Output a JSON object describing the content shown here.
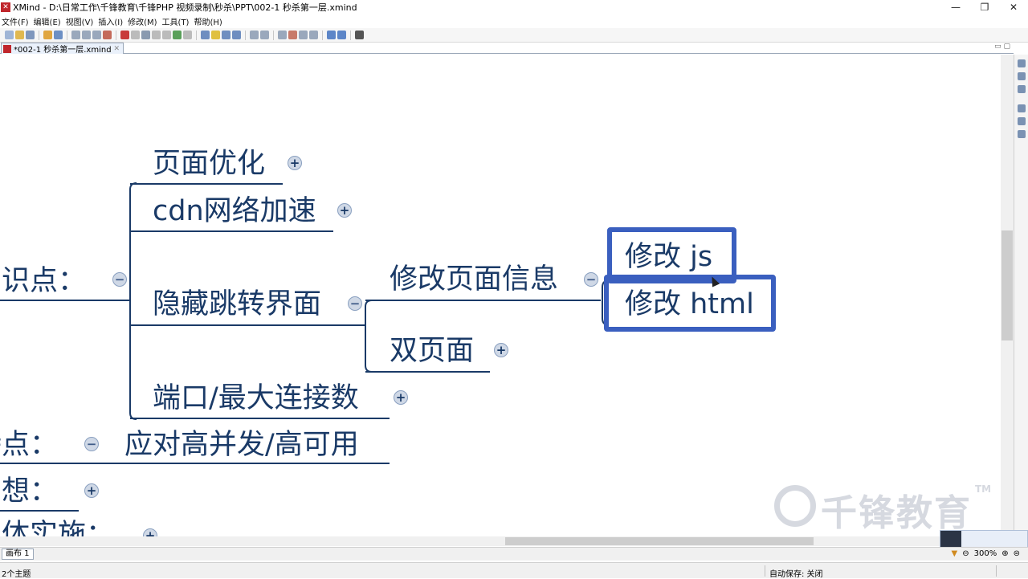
{
  "window": {
    "title": "XMind - D:\\日常工作\\千锋教育\\千锋PHP 视频录制\\秒杀\\PPT\\002-1 秒杀第一层.xmind",
    "minimize": "—",
    "restore": "❐",
    "close": "✕"
  },
  "menu": [
    "文件(F)",
    "编辑(E)",
    "视图(V)",
    "插入(I)",
    "修改(M)",
    "工具(T)",
    "帮助(H)"
  ],
  "editor_tab": {
    "label": "*002-1 秒杀第一层.xmind",
    "close": "✕",
    "minmax": "▭ ▢"
  },
  "mindmap": {
    "branch_labels": {
      "knowledge": "知识点：",
      "features": "特点：",
      "idea": "构想：",
      "implement": "具体实施："
    },
    "knowledge_children": [
      "页面优化",
      "cdn网络加速",
      "隐藏跳转界面",
      "端口/最大连接数"
    ],
    "hidden_children": [
      "修改页面信息",
      "双页面"
    ],
    "modify_children": [
      "修改 js",
      "修改 html"
    ],
    "features_value": "应对高并发/高可用",
    "toggle_plus": "+",
    "toggle_minus": "−"
  },
  "watermark": {
    "text": "千锋教育",
    "tm": "TM"
  },
  "sheet": {
    "tab": "画布 1",
    "zoom": "300%"
  },
  "status": {
    "topics": "2个主题",
    "autosave": "自动保存: 关闭"
  },
  "colors": {
    "topic_text": "#1a3a67",
    "connector": "#1a3a67",
    "highlight_border": "#3a5fbf",
    "toggle_fill": "#cfd8e6"
  }
}
